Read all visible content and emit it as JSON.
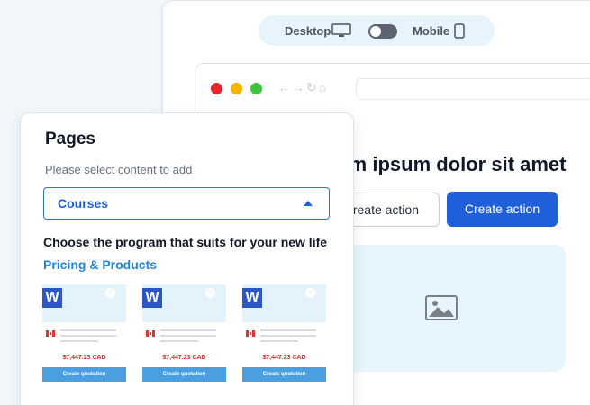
{
  "preview_toggle": {
    "desktop_label": "Desktop",
    "mobile_label": "Mobile",
    "mode": "desktop"
  },
  "browser": {
    "hero_title": "Lorem ipsum dolor sit amet",
    "secondary_action": "Create action",
    "primary_action": "Create action"
  },
  "pages_panel": {
    "title": "Pages",
    "hint": "Please select content to add",
    "selected": "Courses",
    "heading": "Choose the program that suits for your new life",
    "link": "Pricing & Products",
    "cards": [
      {
        "logo": "W",
        "price": "$7,447.23 CAD",
        "cta": "Create quotation"
      },
      {
        "logo": "W",
        "price": "$7,447.23 CAD",
        "cta": "Create quotation"
      },
      {
        "logo": "W",
        "price": "$7,447.23 CAD",
        "cta": "Create quotation"
      }
    ]
  },
  "colors": {
    "primary": "#1f5fd9",
    "link": "#2384d6",
    "price": "#e0322f",
    "card_cta": "#4a9fe0"
  },
  "icons": [
    "monitor-icon",
    "phone-icon",
    "back-arrow-icon",
    "forward-arrow-icon",
    "refresh-icon",
    "home-icon",
    "image-icon",
    "heart-icon",
    "canada-flag-icon",
    "caret-up-icon"
  ]
}
